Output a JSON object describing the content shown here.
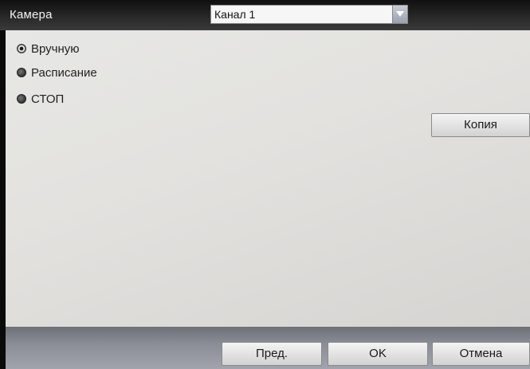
{
  "header": {
    "title": "Камера",
    "channel": {
      "selected": "Канал 1",
      "arrow_icon": "chevron-down-icon"
    }
  },
  "mode": {
    "options": [
      {
        "label": "Вручную",
        "selected": true
      },
      {
        "label": "Расписание",
        "selected": false
      },
      {
        "label": "СТОП",
        "selected": false
      }
    ]
  },
  "buttons": {
    "copy": "Копия",
    "prev": "Пред.",
    "ok": "OK",
    "cancel": "Отмена"
  },
  "colors": {
    "panel": "#e3e2df",
    "footer": "#8a8d96",
    "header": "#2a2a2a"
  }
}
